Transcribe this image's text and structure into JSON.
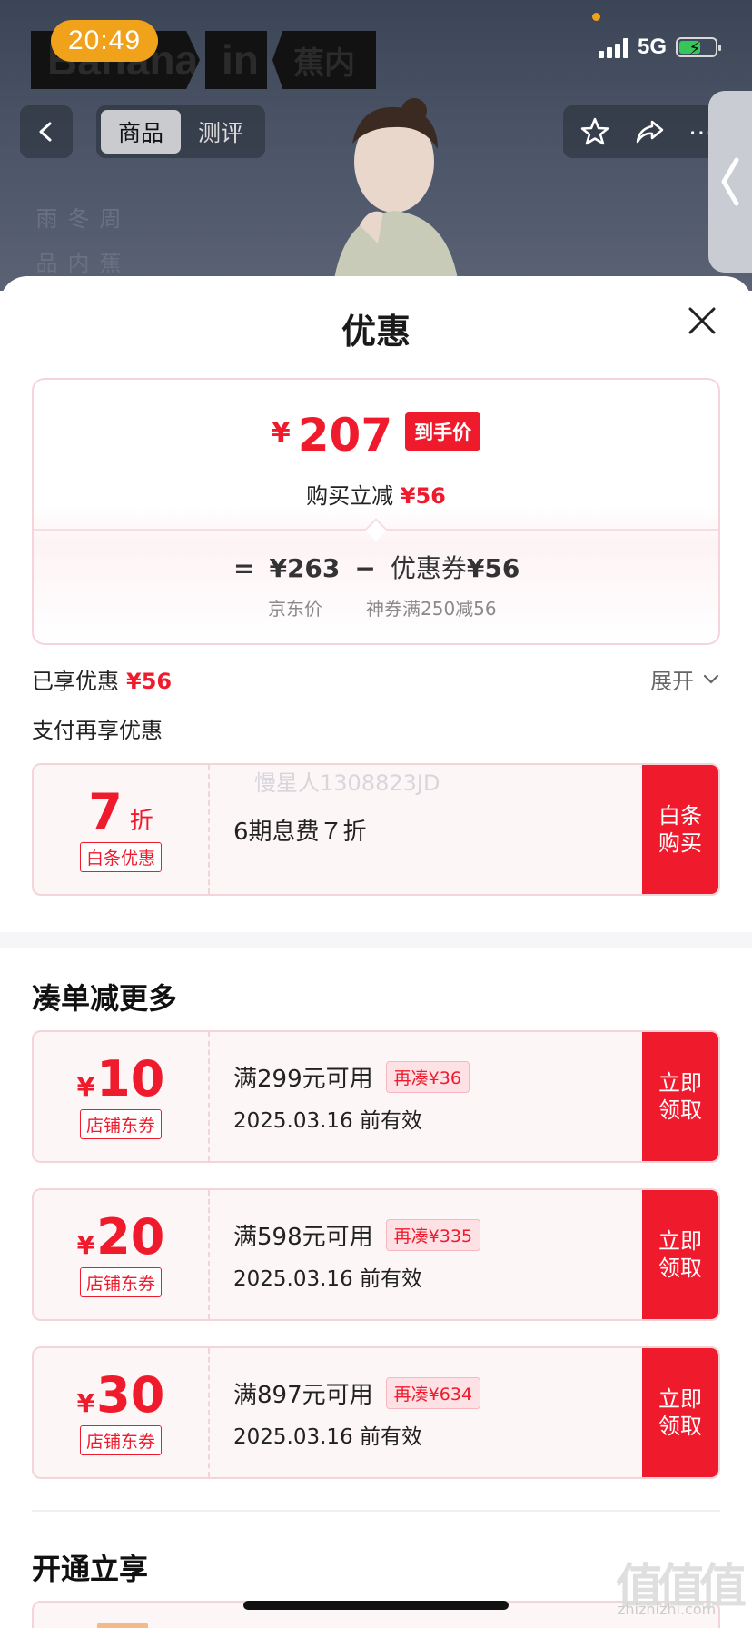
{
  "status_bar": {
    "time": "20:49",
    "network": "5G"
  },
  "brand": {
    "part1": "Banana",
    "part2": "in",
    "part3": "蕉内"
  },
  "nav": {
    "tabs": [
      {
        "label": "商品"
      },
      {
        "label": "测评"
      }
    ]
  },
  "banner": {
    "vertical_text": [
      "周冬雨",
      "蕉内品"
    ]
  },
  "sheet": {
    "title": "优惠",
    "price": {
      "yen": "¥",
      "amount": "207",
      "tag": "到手价",
      "buy_reduce_label": "购买立减",
      "buy_reduce_value": "¥56"
    },
    "formula": {
      "equals": "=",
      "jd_price": "¥263",
      "minus": "−",
      "coupon_label": "优惠券",
      "coupon_value": "¥56",
      "jd_price_label": "京东价",
      "coupon_desc": "神券满250减56"
    },
    "enjoyed": {
      "label": "已享优惠",
      "value": "¥56"
    },
    "expand_label": "展开",
    "pay_more_label": "支付再享优惠",
    "baitiao": {
      "amount": "7",
      "unit": "折",
      "badge": "白条优惠",
      "desc": "6期息费７折",
      "button": "白条\n购买"
    },
    "watermark": "慢星人1308823JD",
    "section_more": "凑单减更多",
    "coupons": [
      {
        "yen": "¥",
        "amount": "10",
        "badge": "店铺东券",
        "condition": "满299元可用",
        "pill": "再凑¥36",
        "date": "2025.03.16 前有效",
        "button": "立即\n领取"
      },
      {
        "yen": "¥",
        "amount": "20",
        "badge": "店铺东券",
        "condition": "满598元可用",
        "pill": "再凑¥335",
        "date": "2025.03.16 前有效",
        "button": "立即\n领取"
      },
      {
        "yen": "¥",
        "amount": "30",
        "badge": "店铺东券",
        "condition": "满897元可用",
        "pill": "再凑¥634",
        "date": "2025.03.16 前有效",
        "button": "立即\n领取"
      }
    ],
    "section_open": "开通立享"
  },
  "corner_watermark": {
    "main": "值值值",
    "sub": "zhizhizhi.com"
  },
  "colors": {
    "accent_red": "#ef1b2d",
    "header_bg": "#4a5466",
    "status_orange": "#f0a21b"
  },
  "icons": [
    "back-arrow-icon",
    "star-icon",
    "share-icon",
    "more-icon",
    "close-icon",
    "chevron-down-icon",
    "chevron-left-icon",
    "battery-icon",
    "signal-icon"
  ]
}
